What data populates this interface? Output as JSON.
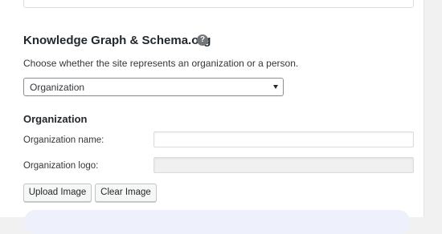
{
  "knowledge_graph": {
    "title": "Knowledge Graph & Schema.org",
    "help_icon": "question-circle-icon",
    "description": "Choose whether the site represents an organization or a person.",
    "represents_select": {
      "value": "Organization",
      "icon": "caret-down-icon"
    }
  },
  "organization": {
    "title": "Organization",
    "name_label": "Organization name:",
    "name_value": "",
    "logo_label": "Organization logo:",
    "logo_value": "",
    "upload_button": "Upload Image",
    "clear_button": "Clear Image"
  }
}
